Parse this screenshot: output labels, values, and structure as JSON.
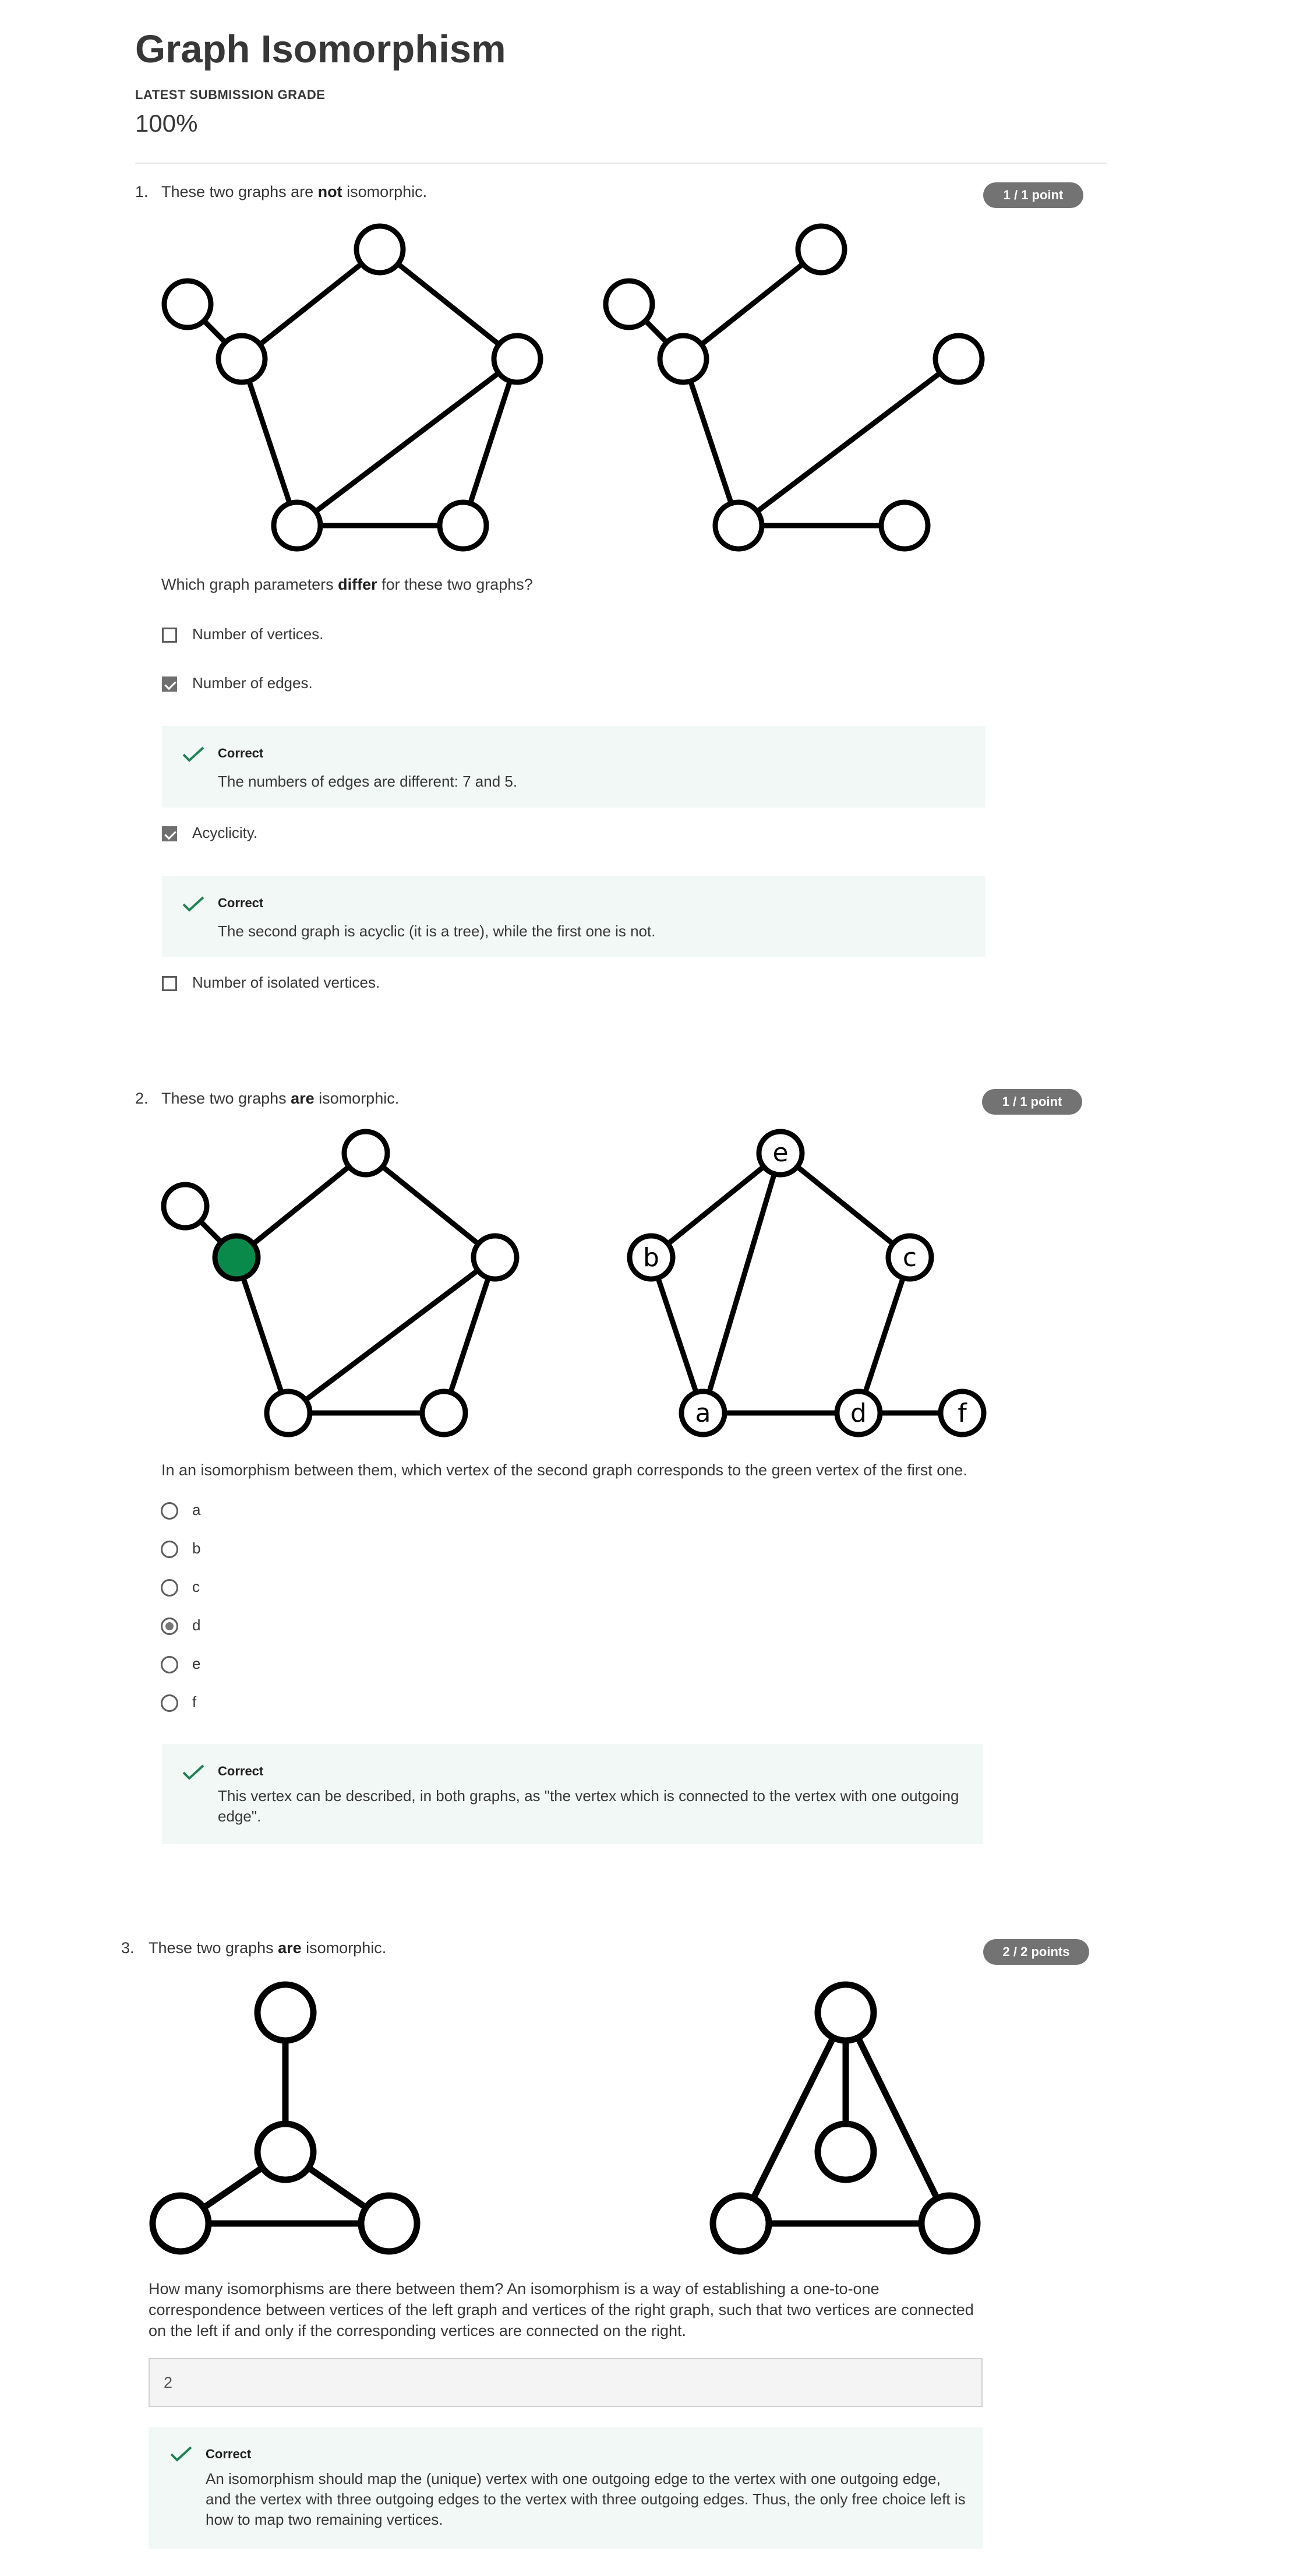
{
  "page": {
    "title": "Graph Isomorphism",
    "grade_label": "LATEST SUBMISSION GRADE",
    "grade_value": "100%"
  },
  "colors": {
    "badge": "#737373",
    "correct_green": "#1f8354",
    "vertex_green": "#0a8a4a",
    "feedback_bg": "#f2f8f6"
  },
  "q1": {
    "number": "1.",
    "text_pre": "These two graphs are ",
    "text_bold": "not",
    "text_post": " isomorphic.",
    "badge": "1 / 1 point",
    "prompt_pre": "Which graph parameters ",
    "prompt_bold": "differ",
    "prompt_post": " for these two graphs?",
    "options": [
      {
        "label": "Number of vertices.",
        "checked": false
      },
      {
        "label": "Number of edges.",
        "checked": true
      },
      {
        "label": "Acyclicity.",
        "checked": true
      },
      {
        "label": "Number of isolated vertices.",
        "checked": false
      }
    ],
    "feedback": [
      {
        "title": "Correct",
        "text": "The numbers of edges are different: 7 and 5."
      },
      {
        "title": "Correct",
        "text": "The second graph is acyclic (it is a tree), while the first one is not."
      }
    ]
  },
  "q2": {
    "number": "2.",
    "text_pre": "These two graphs ",
    "text_bold": "are",
    "text_post": " isomorphic.",
    "badge": "1 / 1 point",
    "prompt": "In an isomorphism between them, which vertex of the second graph corresponds to the green vertex of the first one.",
    "vertex_labels": [
      "a",
      "b",
      "c",
      "d",
      "e",
      "f"
    ],
    "options": [
      {
        "label": "a",
        "checked": false
      },
      {
        "label": "b",
        "checked": false
      },
      {
        "label": "c",
        "checked": false
      },
      {
        "label": "d",
        "checked": true
      },
      {
        "label": "e",
        "checked": false
      },
      {
        "label": "f",
        "checked": false
      }
    ],
    "feedback": {
      "title": "Correct",
      "text": "This vertex can be described, in both graphs, as \"the vertex which is connected to the vertex with one outgoing edge\"."
    }
  },
  "q3": {
    "number": "3.",
    "text_pre": "These two graphs ",
    "text_bold": "are",
    "text_post": " isomorphic.",
    "badge": "2 / 2 points",
    "prompt": "How many isomorphisms are there between them? An isomorphism is a way of establishing a one-to-one correspondence between vertices of the left graph and vertices of the right graph, such that two vertices are connected on the left if and only if the corresponding vertices are connected on the right.",
    "answer": "2",
    "feedback": {
      "title": "Correct",
      "text": "An isomorphism should map the (unique) vertex with one outgoing edge to the vertex with one outgoing edge, and the vertex with three outgoing edges to the vertex with three outgoing edges. Thus, the only free choice left is how to map two remaining vertices."
    }
  }
}
